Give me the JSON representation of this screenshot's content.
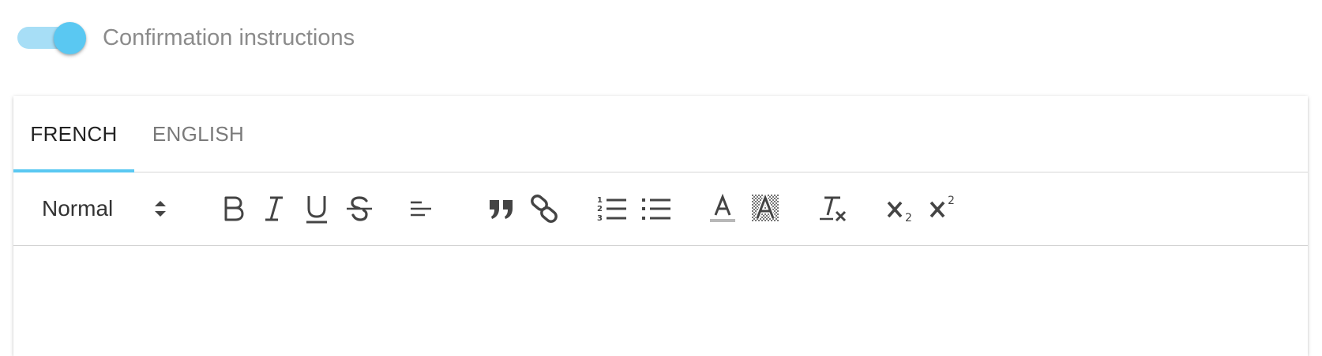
{
  "toggle": {
    "label": "Confirmation instructions",
    "checked": true,
    "track_color": "#a7def6",
    "knob_color": "#5ac8f2"
  },
  "tabs": [
    {
      "label": "FRENCH",
      "active": true
    },
    {
      "label": "ENGLISH",
      "active": false
    }
  ],
  "toolbar": {
    "format_picker": {
      "selected": "Normal"
    },
    "buttons": [
      {
        "name": "bold-icon"
      },
      {
        "name": "italic-icon"
      },
      {
        "name": "underline-icon"
      },
      {
        "name": "strikethrough-icon"
      },
      {
        "name": "align-left-icon"
      },
      {
        "name": "blockquote-icon"
      },
      {
        "name": "link-icon"
      },
      {
        "name": "ordered-list-icon"
      },
      {
        "name": "bullet-list-icon"
      },
      {
        "name": "text-color-icon"
      },
      {
        "name": "background-color-icon"
      },
      {
        "name": "clear-formatting-icon"
      },
      {
        "name": "subscript-icon"
      },
      {
        "name": "superscript-icon"
      }
    ]
  },
  "colors": {
    "accent": "#5ac8f2",
    "icon": "#444444",
    "label_muted": "#8b8b8b"
  }
}
